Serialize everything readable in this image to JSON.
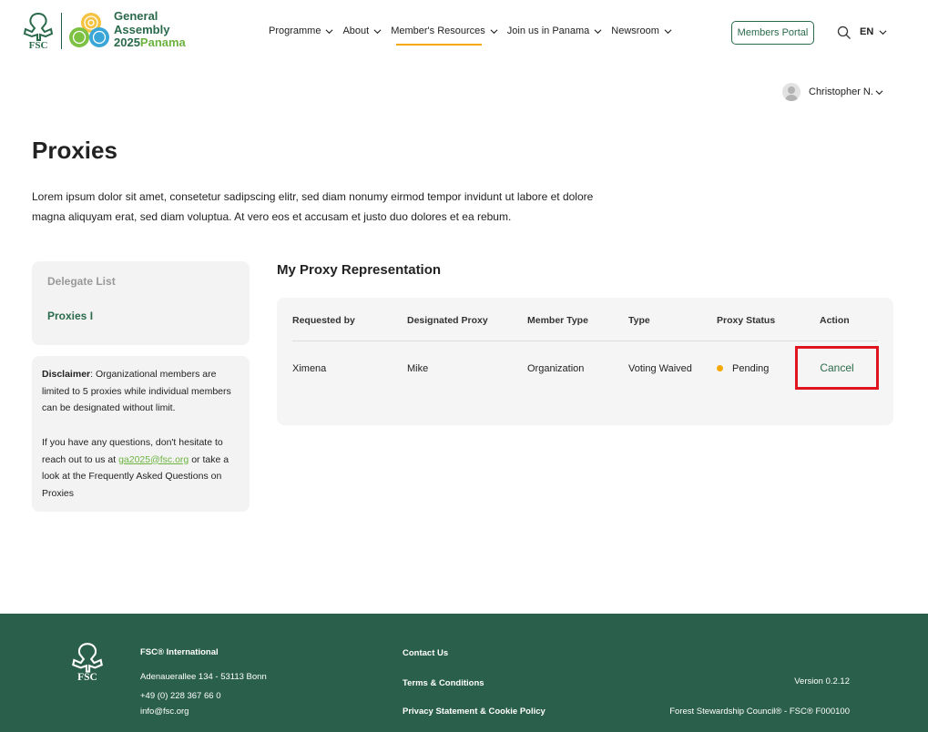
{
  "brand": {
    "fsc_logo": "fsc-tree-logo",
    "ga_logo": "general-assembly-swirl-logo",
    "title_line1": "General",
    "title_line2": "Assembly",
    "title_year": "2025",
    "title_place": "Panama",
    "colors": {
      "primary": "#2a6a4b",
      "accent": "#6cb33f",
      "highlight": "#f5a800",
      "alert": "#e0141e",
      "footer": "#2a5f4c"
    }
  },
  "nav": {
    "items": [
      {
        "label": "Programme"
      },
      {
        "label": "About"
      },
      {
        "label": "Member's Resources"
      },
      {
        "label": "Join us in Panama"
      },
      {
        "label": "Newsroom"
      }
    ],
    "active_index": 2,
    "portal_label": "Members Portal",
    "search_icon": "search-icon",
    "lang": "EN"
  },
  "user": {
    "name": "Christopher N."
  },
  "page": {
    "title": "Proxies",
    "intro": "Lorem ipsum dolor sit amet, consetetur sadipscing elitr, sed diam nonumy eirmod tempor invidunt ut labore et dolore magna aliquyam erat, sed diam voluptua. At vero eos et accusam et justo duo dolores et ea rebum."
  },
  "sidebar": {
    "items": [
      {
        "label": "Delegate List"
      },
      {
        "label": "Proxies I"
      }
    ],
    "disclaimer_label": "Disclaimer",
    "disclaimer_text": ": Organizational members are limited to 5 proxies while individual members can be designated without limit.",
    "help_pre": "If you have any questions, don't hesitate to reach out to us at ",
    "help_email": "ga2025@fsc.org",
    "help_post": " or take a look at the Frequently Asked Questions on Proxies"
  },
  "proxy": {
    "section_title": "My Proxy Representation",
    "columns": [
      "Requested by",
      "Designated Proxy",
      "Member Type",
      "Type",
      "Proxy Status",
      "Action"
    ],
    "rows": [
      {
        "requested_by": "Ximena",
        "designated_proxy": "Mike",
        "member_type": "Organization",
        "type": "Voting Waived",
        "status": "Pending",
        "action": "Cancel"
      }
    ]
  },
  "footer": {
    "org": "FSC® International",
    "address": "Adenauerallee 134 - 53113 Bonn",
    "phone": "+49 (0) 228 367 66 0",
    "email": "info@fsc.org",
    "links": [
      "Contact Us",
      "Terms & Conditions",
      "Privacy Statement & Cookie Policy"
    ],
    "version": "Version 0.2.12",
    "copyright": "Forest Stewardship Council® - FSC® F000100"
  }
}
